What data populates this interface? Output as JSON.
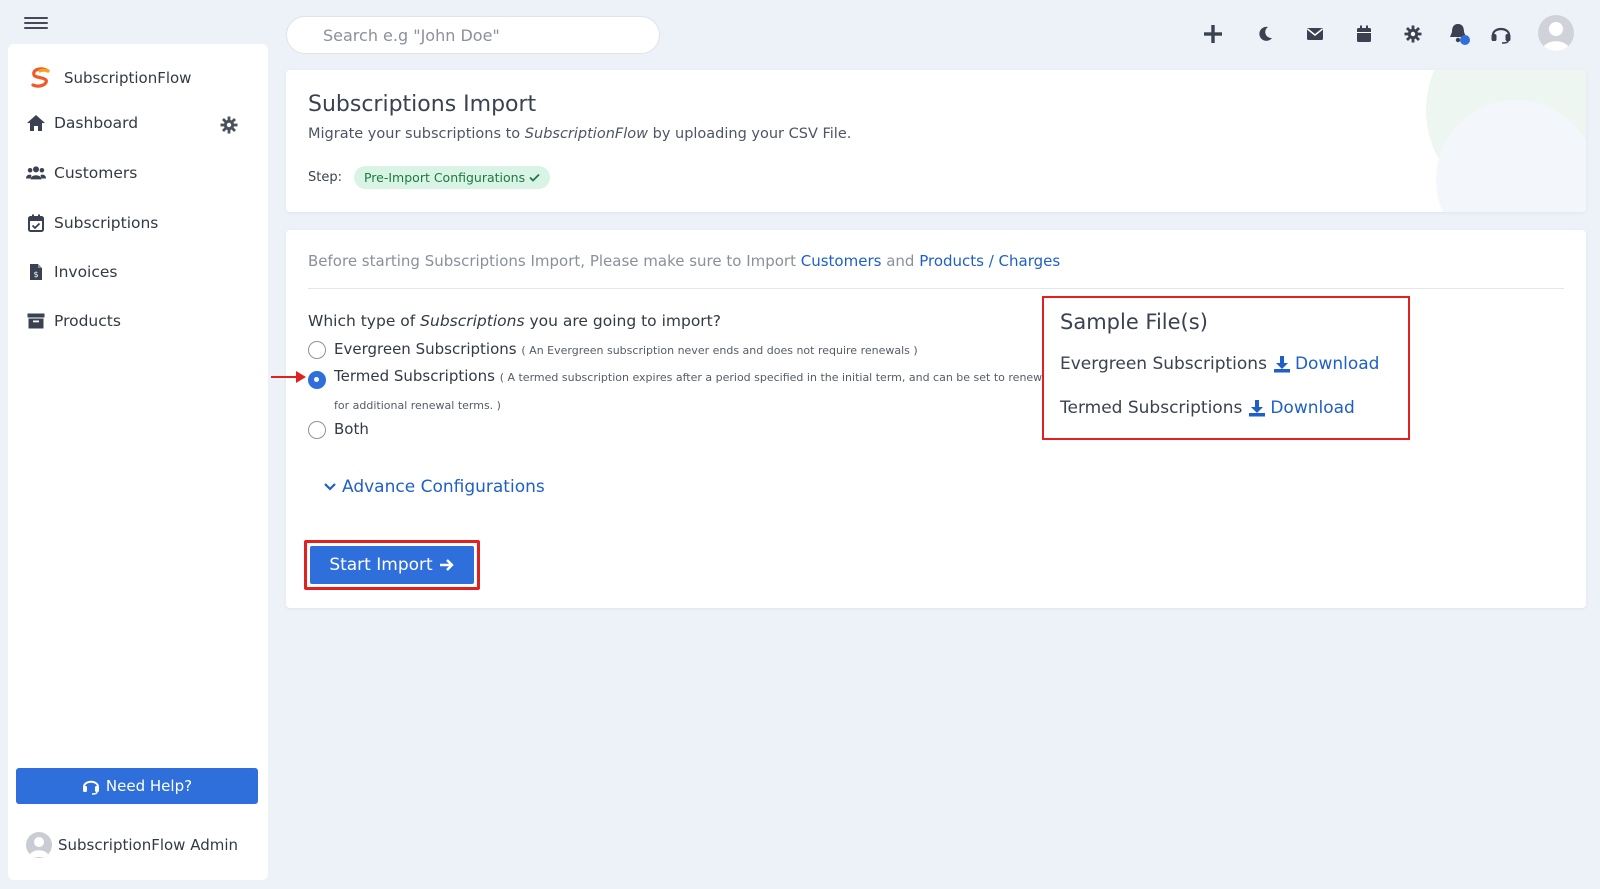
{
  "sidebar": {
    "brand": "SubscriptionFlow",
    "items": [
      {
        "label": "Dashboard"
      },
      {
        "label": "Customers"
      },
      {
        "label": "Subscriptions"
      },
      {
        "label": "Invoices"
      },
      {
        "label": "Products"
      }
    ],
    "help_label": "Need Help?",
    "user_name": "SubscriptionFlow Admin"
  },
  "header": {
    "search_placeholder": "Search e.g \"John Doe\"",
    "icons": [
      "plus-icon",
      "moon-icon",
      "envelope-icon",
      "calendar-icon",
      "gear-icon",
      "bell-icon",
      "headset-icon",
      "user-avatar"
    ]
  },
  "page": {
    "title": "Subscriptions Import",
    "subtitle_prefix": "Migrate your subscriptions to ",
    "subtitle_brand": "SubscriptionFlow",
    "subtitle_suffix": " by uploading your CSV File.",
    "step_label": "Step:",
    "step_value": "Pre-Import Configurations"
  },
  "import": {
    "note_prefix": "Before starting Subscriptions Import, Please make sure to Import ",
    "link_customers": "Customers",
    "note_and": " and ",
    "link_products": "Products / Charges",
    "question_prefix": "Which type of ",
    "question_em": "Subscriptions",
    "question_suffix": " you are going to import?",
    "options": [
      {
        "label": "Evergreen Subscriptions",
        "desc": "( An Evergreen subscription never ends and does not require renewals )",
        "checked": false
      },
      {
        "label": "Termed Subscriptions",
        "desc": "( A termed subscription expires after a period specified in the initial term, and can be set to renew for additional renewal terms. )",
        "checked": true
      },
      {
        "label": "Both",
        "desc": "",
        "checked": false
      }
    ],
    "advance_label": "Advance Configurations",
    "start_label": "Start Import"
  },
  "samples": {
    "title": "Sample File(s)",
    "rows": [
      {
        "label": "Evergreen Subscriptions",
        "link": "Download"
      },
      {
        "label": "Termed Subscriptions",
        "link": "Download"
      }
    ]
  },
  "colors": {
    "accent": "#2f6fdc",
    "link": "#1f5fc9",
    "highlight": "#e32020",
    "badge_bg": "#d9f4e4",
    "badge_text": "#1c7a45"
  }
}
